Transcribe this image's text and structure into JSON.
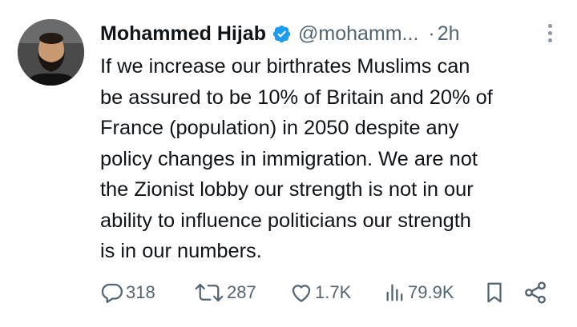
{
  "author": {
    "name": "Mohammed Hijab",
    "handle": "@mohamm...",
    "separator": "·",
    "time": "2h",
    "verified_color": "#1d9bf0"
  },
  "tweet": {
    "text": "If we increase our birthrates Muslims can\nbe assured to be 10% of Britain and 20% of\nFrance (population) in 2050 despite any\npolicy changes in immigration. We are not\nthe Zionist lobby our strength is not in our\nability to influence politicians our strength\nis in our numbers."
  },
  "actions": {
    "replies": "318",
    "retweets": "287",
    "likes": "1.7K",
    "views": "79.9K"
  },
  "icons": {
    "reply": "reply-icon",
    "retweet": "retweet-icon",
    "like": "heart-icon",
    "views": "views-icon",
    "bookmark": "bookmark-icon",
    "share": "share-icon",
    "more": "more-vertical-icon"
  },
  "colors": {
    "text": "#0f1419",
    "secondary": "#536471",
    "verified": "#1d9bf0"
  }
}
